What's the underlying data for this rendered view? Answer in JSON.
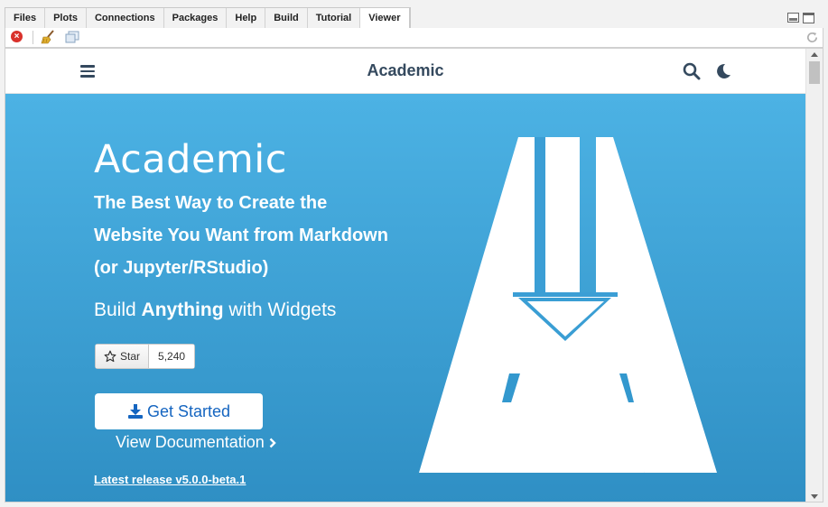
{
  "pane": {
    "tabs": [
      {
        "label": "Files"
      },
      {
        "label": "Plots"
      },
      {
        "label": "Connections"
      },
      {
        "label": "Packages"
      },
      {
        "label": "Help"
      },
      {
        "label": "Build"
      },
      {
        "label": "Tutorial"
      },
      {
        "label": "Viewer"
      }
    ],
    "active_tab": "Viewer"
  },
  "toolbar": {
    "icons": [
      "stop-icon",
      "clear-broom-icon",
      "popout-icon",
      "refresh-icon"
    ]
  },
  "site": {
    "brand": "Academic",
    "hero": {
      "title": "Academic",
      "subtitle": "The Best Way to Create the Website You Want from Markdown (or Jupyter/RStudio)",
      "widgets_prefix": "Build",
      "widgets_bold": "Anything",
      "widgets_suffix": "with Widgets",
      "star_label": "Star",
      "star_count": "5,240",
      "cta_label": "Get Started",
      "docs_label": "View Documentation",
      "latest_release": "Latest release v5.0.0-beta.1"
    }
  },
  "colors": {
    "hero_top": "#4cb2e4",
    "hero_bottom": "#2f8fc4",
    "nav_text": "#34495e",
    "cta_text": "#1565c0"
  }
}
